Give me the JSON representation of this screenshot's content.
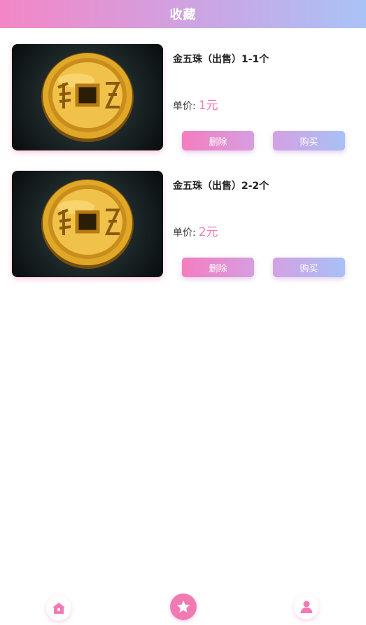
{
  "header": {
    "title": "收藏"
  },
  "items": [
    {
      "title": "金五珠（出售）1-1个",
      "price_label": "单价:",
      "price": "1元",
      "delete_label": "删除",
      "buy_label": "购买",
      "image": "gold-coin-image"
    },
    {
      "title": "金五珠（出售）2-2个",
      "price_label": "单价:",
      "price": "2元",
      "delete_label": "删除",
      "buy_label": "购买",
      "image": "gold-coin-image"
    }
  ],
  "tabbar": {
    "home_icon": "home-icon",
    "favorites_icon": "star-icon",
    "profile_icon": "user-icon"
  },
  "colors": {
    "accent": "#f27ab3",
    "header_start": "#f486c6",
    "header_end": "#a9c3f6"
  }
}
